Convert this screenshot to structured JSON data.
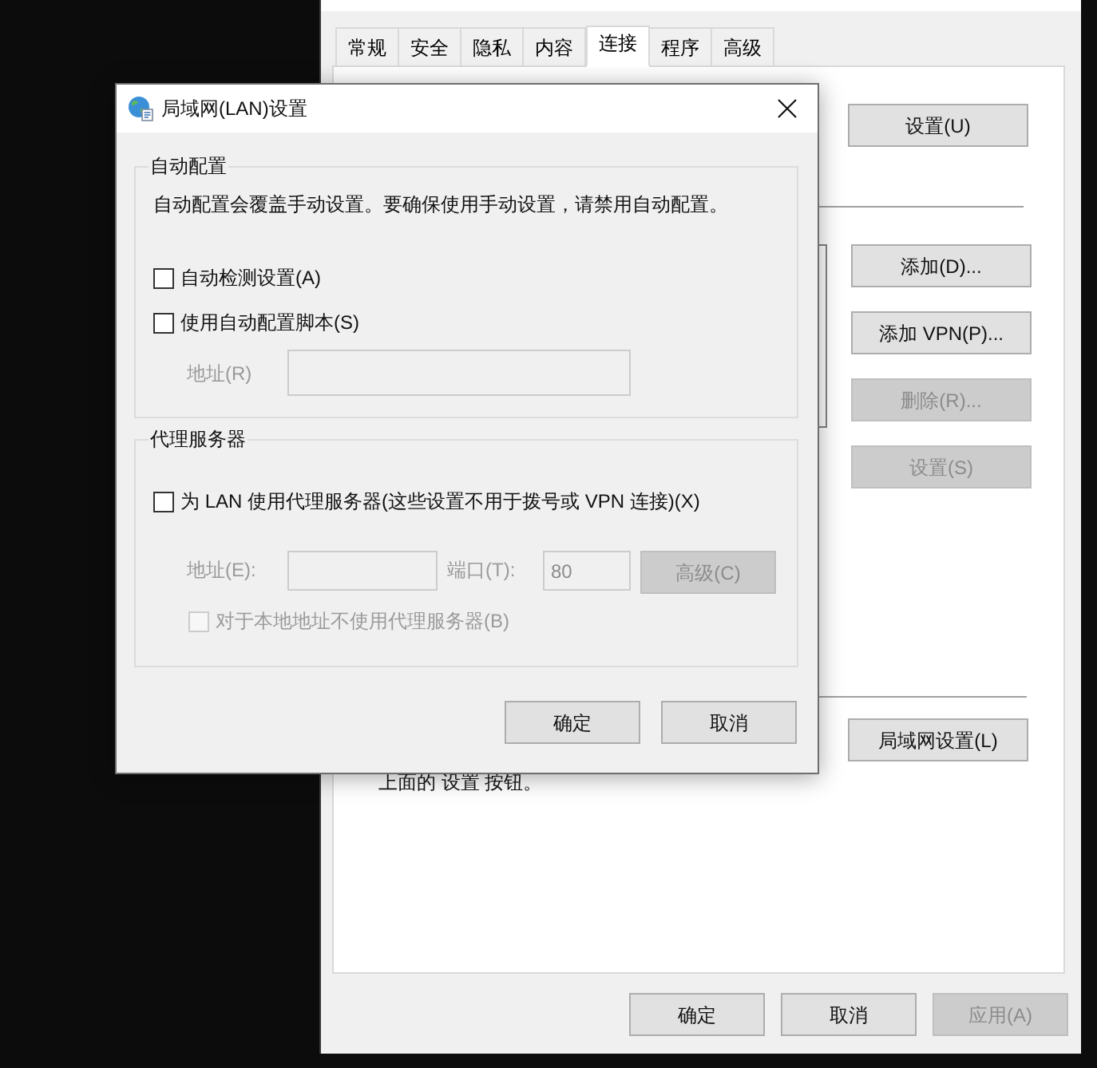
{
  "background_window": {
    "tabs": [
      {
        "label": "常规",
        "selected": false
      },
      {
        "label": "安全",
        "selected": false
      },
      {
        "label": "隐私",
        "selected": false
      },
      {
        "label": "内容",
        "selected": false
      },
      {
        "label": "连接",
        "selected": true
      },
      {
        "label": "程序",
        "selected": false
      },
      {
        "label": "高级",
        "selected": false
      }
    ],
    "panel": {
      "setup_button": {
        "label": "设置(U)",
        "disabled": false
      },
      "connection_buttons": [
        {
          "label": "添加(D)...",
          "disabled": false
        },
        {
          "label": "添加 VPN(P)...",
          "disabled": false
        },
        {
          "label": "删除(R)...",
          "disabled": true
        },
        {
          "label": "设置(S)",
          "disabled": true
        }
      ],
      "lan_note": "上面的 设置 按钮。",
      "lan_settings_button": {
        "label": "局域网设置(L)",
        "disabled": false
      }
    },
    "buttons": [
      {
        "label": "确定",
        "disabled": false
      },
      {
        "label": "取消",
        "disabled": false
      },
      {
        "label": "应用(A)",
        "disabled": true
      }
    ]
  },
  "dialog": {
    "title": "局域网(LAN)设置",
    "auto_config": {
      "title": "自动配置",
      "description": "自动配置会覆盖手动设置。要确保使用手动设置，请禁用自动配置。",
      "options": [
        {
          "label": "自动检测设置(A)",
          "checked": false,
          "disabled": false
        },
        {
          "label": "使用自动配置脚本(S)",
          "checked": false,
          "disabled": false
        }
      ],
      "address": {
        "label": "地址(R)",
        "disabled": true
      }
    },
    "proxy": {
      "title": "代理服务器",
      "use_proxy": {
        "label": "为 LAN 使用代理服务器(这些设置不用于拨号或 VPN 连接)(X)",
        "checked": false,
        "disabled": false
      },
      "address": {
        "label": "地址(E):",
        "disabled": true
      },
      "port": {
        "label": "端口(T):",
        "value": "80",
        "disabled": true
      },
      "advanced_button": {
        "label": "高级(C)",
        "disabled": true
      },
      "bypass_local": {
        "label": "对于本地地址不使用代理服务器(B)",
        "checked": false,
        "disabled": true
      }
    },
    "buttons": [
      {
        "label": "确定",
        "disabled": false
      },
      {
        "label": "取消",
        "disabled": false
      }
    ]
  }
}
